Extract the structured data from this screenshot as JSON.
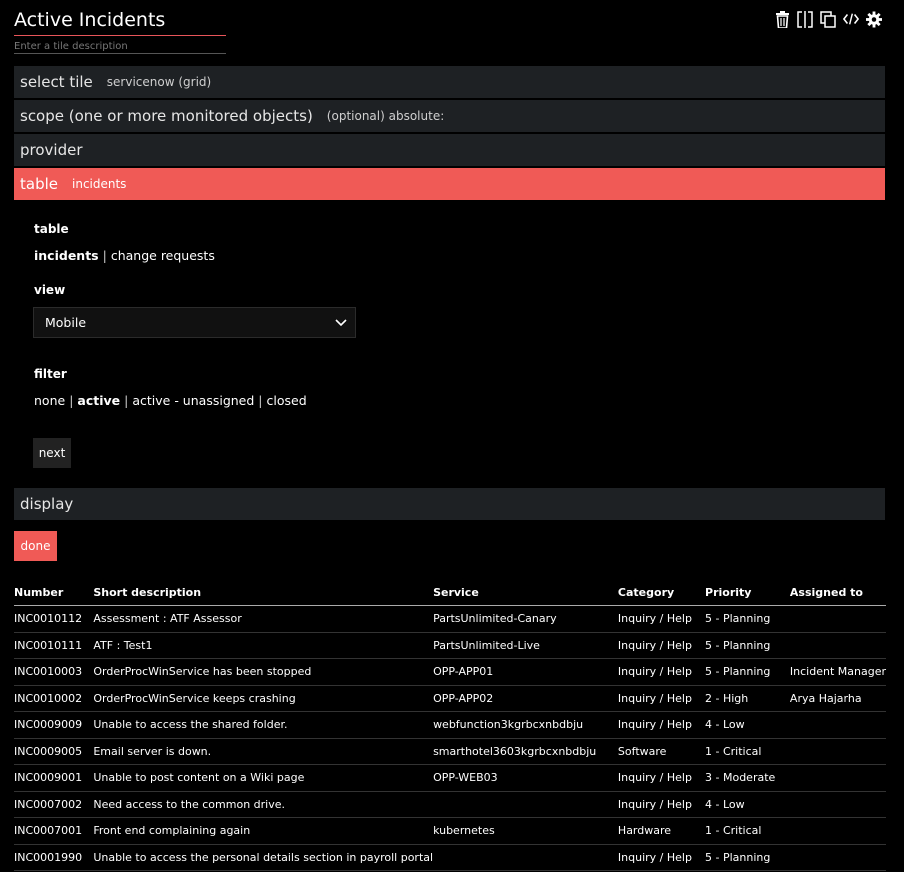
{
  "tile": {
    "title": "Active Incidents",
    "description_placeholder": "Enter a tile description"
  },
  "toolbar": {
    "icons": [
      "trash-icon",
      "split-icon",
      "copy-icon",
      "code-icon",
      "gear-icon"
    ]
  },
  "sections": {
    "select_tile": {
      "label": "select tile",
      "value": "servicenow (grid)"
    },
    "scope": {
      "label": "scope (one or more monitored objects)",
      "value": "(optional) absolute:"
    },
    "provider": {
      "label": "provider"
    },
    "table": {
      "label": "table",
      "value": "incidents"
    },
    "display": {
      "label": "display"
    }
  },
  "form": {
    "table_label": "table",
    "table_options": [
      "incidents",
      "change requests"
    ],
    "table_selected": "incidents",
    "view_label": "view",
    "view_value": "Mobile",
    "filter_label": "filter",
    "filter_options": [
      "none",
      "active",
      "active - unassigned",
      "closed"
    ],
    "filter_selected": "active",
    "next_label": "next",
    "done_label": "done"
  },
  "grid": {
    "headers": [
      "Number",
      "Short description",
      "Service",
      "Category",
      "Priority",
      "Assigned to"
    ],
    "rows": [
      [
        "INC0010112",
        "Assessment : ATF Assessor",
        "PartsUnlimited-Canary",
        "Inquiry / Help",
        "5 - Planning",
        ""
      ],
      [
        "INC0010111",
        "ATF : Test1",
        "PartsUnlimited-Live",
        "Inquiry / Help",
        "5 - Planning",
        ""
      ],
      [
        "INC0010003",
        "OrderProcWinService has been stopped",
        "OPP-APP01",
        "Inquiry / Help",
        "5 - Planning",
        "Incident Manager"
      ],
      [
        "INC0010002",
        "OrderProcWinService keeps crashing",
        "OPP-APP02",
        "Inquiry / Help",
        "2 - High",
        "Arya Hajarha"
      ],
      [
        "INC0009009",
        "Unable to access the shared folder.",
        "webfunction3kgrbcxnbdbju",
        "Inquiry / Help",
        "4 - Low",
        ""
      ],
      [
        "INC0009005",
        "Email server is down.",
        "smarthotel3603kgrbcxnbdbju",
        "Software",
        "1 - Critical",
        ""
      ],
      [
        "INC0009001",
        "Unable to post content on a Wiki page",
        "OPP-WEB03",
        "Inquiry / Help",
        "3 - Moderate",
        ""
      ],
      [
        "INC0007002",
        "Need access to the common drive.",
        "",
        "Inquiry / Help",
        "4 - Low",
        ""
      ],
      [
        "INC0007001",
        "Front end complaining again",
        "kubernetes",
        "Hardware",
        "1 - Critical",
        ""
      ],
      [
        "INC0001990",
        "Unable to access the personal details section in payroll portal",
        "",
        "Inquiry / Help",
        "5 - Planning",
        ""
      ]
    ]
  }
}
